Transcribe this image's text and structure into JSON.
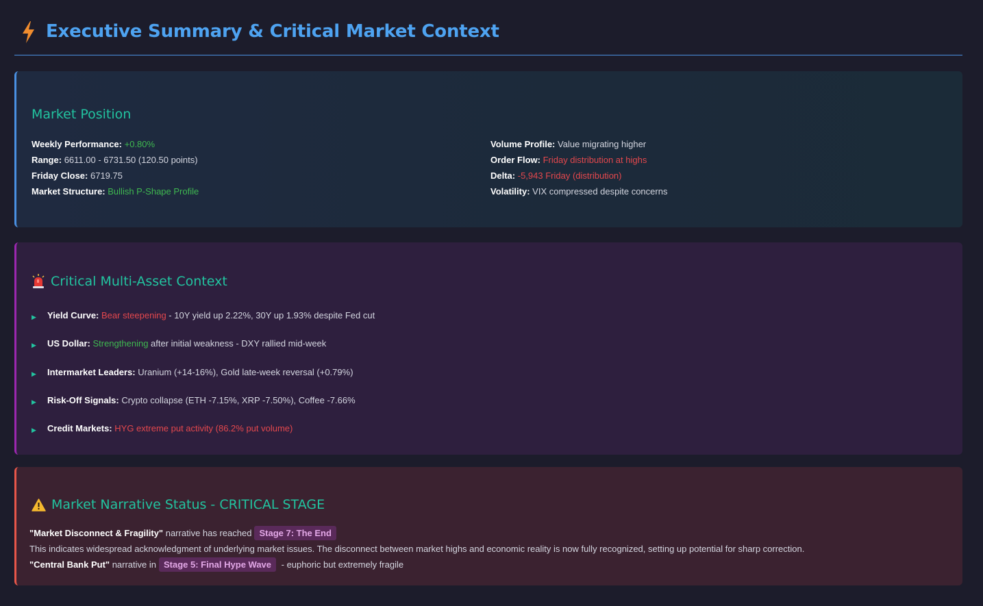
{
  "header": {
    "title": "Executive Summary & Critical Market Context",
    "icon": "lightning-bolt-icon"
  },
  "market_position": {
    "title": "Market Position",
    "left": [
      {
        "label": "Weekly Performance:",
        "value": "+0.80%",
        "tone": "green"
      },
      {
        "label": "Range:",
        "value": "6611.00 - 6731.50 (120.50 points)",
        "tone": "plain"
      },
      {
        "label": "Friday Close:",
        "value": "6719.75",
        "tone": "plain"
      },
      {
        "label": "Market Structure:",
        "value": "Bullish P-Shape Profile",
        "tone": "green"
      }
    ],
    "right": [
      {
        "label": "Volume Profile:",
        "value": "Value migrating higher",
        "tone": "plain"
      },
      {
        "label": "Order Flow:",
        "value": "Friday distribution at highs",
        "tone": "red"
      },
      {
        "label": "Delta:",
        "value": "-5,943 Friday (distribution)",
        "tone": "red"
      },
      {
        "label": "Volatility:",
        "value": "VIX compressed despite concerns",
        "tone": "plain"
      }
    ]
  },
  "multi_asset": {
    "title": "Critical Multi-Asset Context",
    "icon": "siren-icon",
    "items": [
      {
        "label": "Yield Curve:",
        "highlight": "Bear steepening",
        "tone": "red",
        "rest": " - 10Y yield up 2.22%, 30Y up 1.93% despite Fed cut"
      },
      {
        "label": "US Dollar:",
        "highlight": "Strengthening",
        "tone": "green",
        "rest": " after initial weakness - DXY rallied mid-week"
      },
      {
        "label": "Intermarket Leaders:",
        "highlight": "",
        "tone": "plain",
        "rest": " Uranium (+14-16%), Gold late-week reversal (+0.79%)"
      },
      {
        "label": "Risk-Off Signals:",
        "highlight": "",
        "tone": "plain",
        "rest": " Crypto collapse (ETH -7.15%, XRP -7.50%), Coffee -7.66%"
      },
      {
        "label": "Credit Markets:",
        "highlight": "HYG extreme put activity (86.2% put volume)",
        "tone": "red",
        "rest": ""
      }
    ]
  },
  "narrative": {
    "title": "Market Narrative Status - CRITICAL STAGE",
    "icon": "warning-icon",
    "line1": {
      "bold": "\"Market Disconnect & Fragility\"",
      "text": " narrative has reached",
      "tag": "Stage 7: The End"
    },
    "line2": "This indicates widespread acknowledgment of underlying market issues. The disconnect between market highs and economic reality is now fully recognized, setting up potential for sharp correction.",
    "line3": {
      "bold": "\"Central Bank Put\"",
      "text": " narrative in",
      "tag": "Stage 5: Final Hype Wave",
      "after": " - euphoric but extremely fragile"
    }
  },
  "colors": {
    "accent": "#4ea3f1",
    "heading": "#22c4a0",
    "green": "#3fb950",
    "red": "#e5484d"
  }
}
